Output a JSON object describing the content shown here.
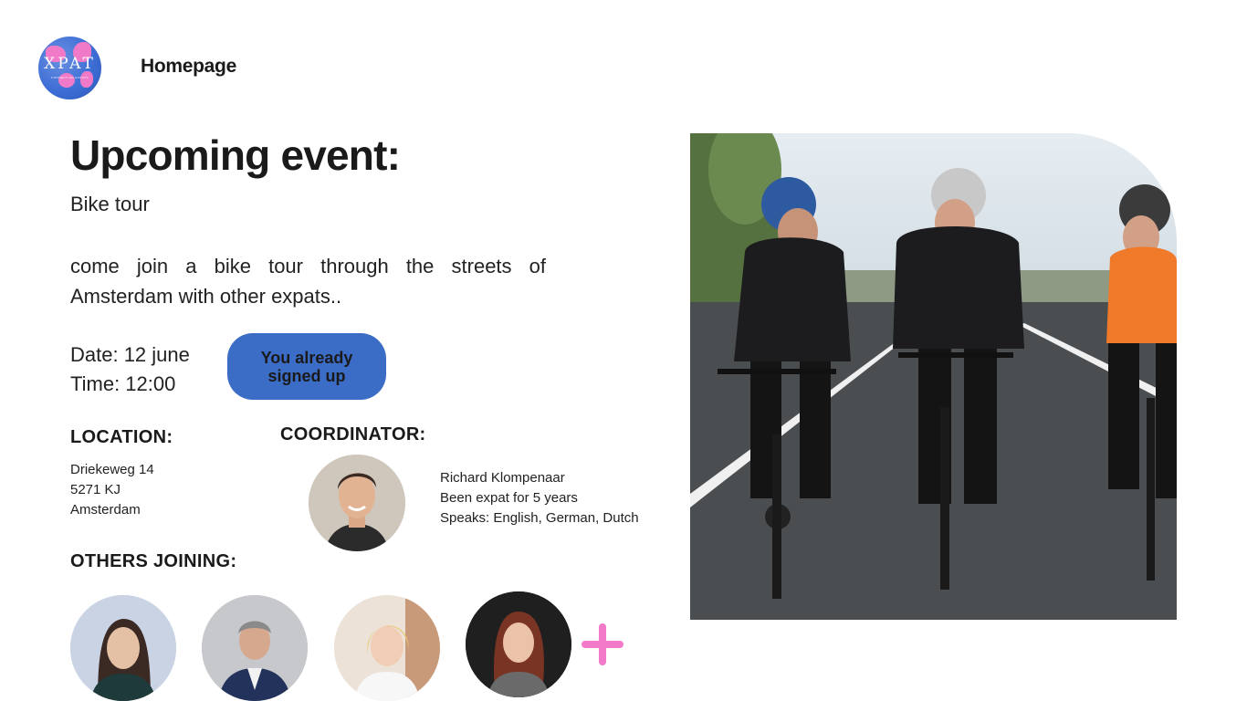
{
  "header": {
    "logo_text": "XPAT",
    "logo_sub": "CONNECTING EXPATS",
    "nav_home": "Homepage"
  },
  "event": {
    "section_title": "Upcoming event:",
    "name": "Bike tour",
    "description": "come join a bike tour through the streets of Amsterdam with other expats..",
    "date": "Date: 12 june",
    "time": "Time: 12:00",
    "signup_button": "You already signed up"
  },
  "location": {
    "label": "LOCATION:",
    "line1": "Driekeweg 14",
    "line2": "5271 KJ",
    "line3": "Amsterdam"
  },
  "coordinator": {
    "label": "COORDINATOR:",
    "name": "Richard Klompenaar",
    "expat_info": "Been expat for 5 years",
    "languages": "Speaks: English, German, Dutch"
  },
  "others": {
    "label": "OTHERS JOINING:",
    "more_icon": "plus-icon"
  },
  "colors": {
    "accent_blue": "#3b6cc6",
    "accent_pink": "#f37ac8"
  }
}
